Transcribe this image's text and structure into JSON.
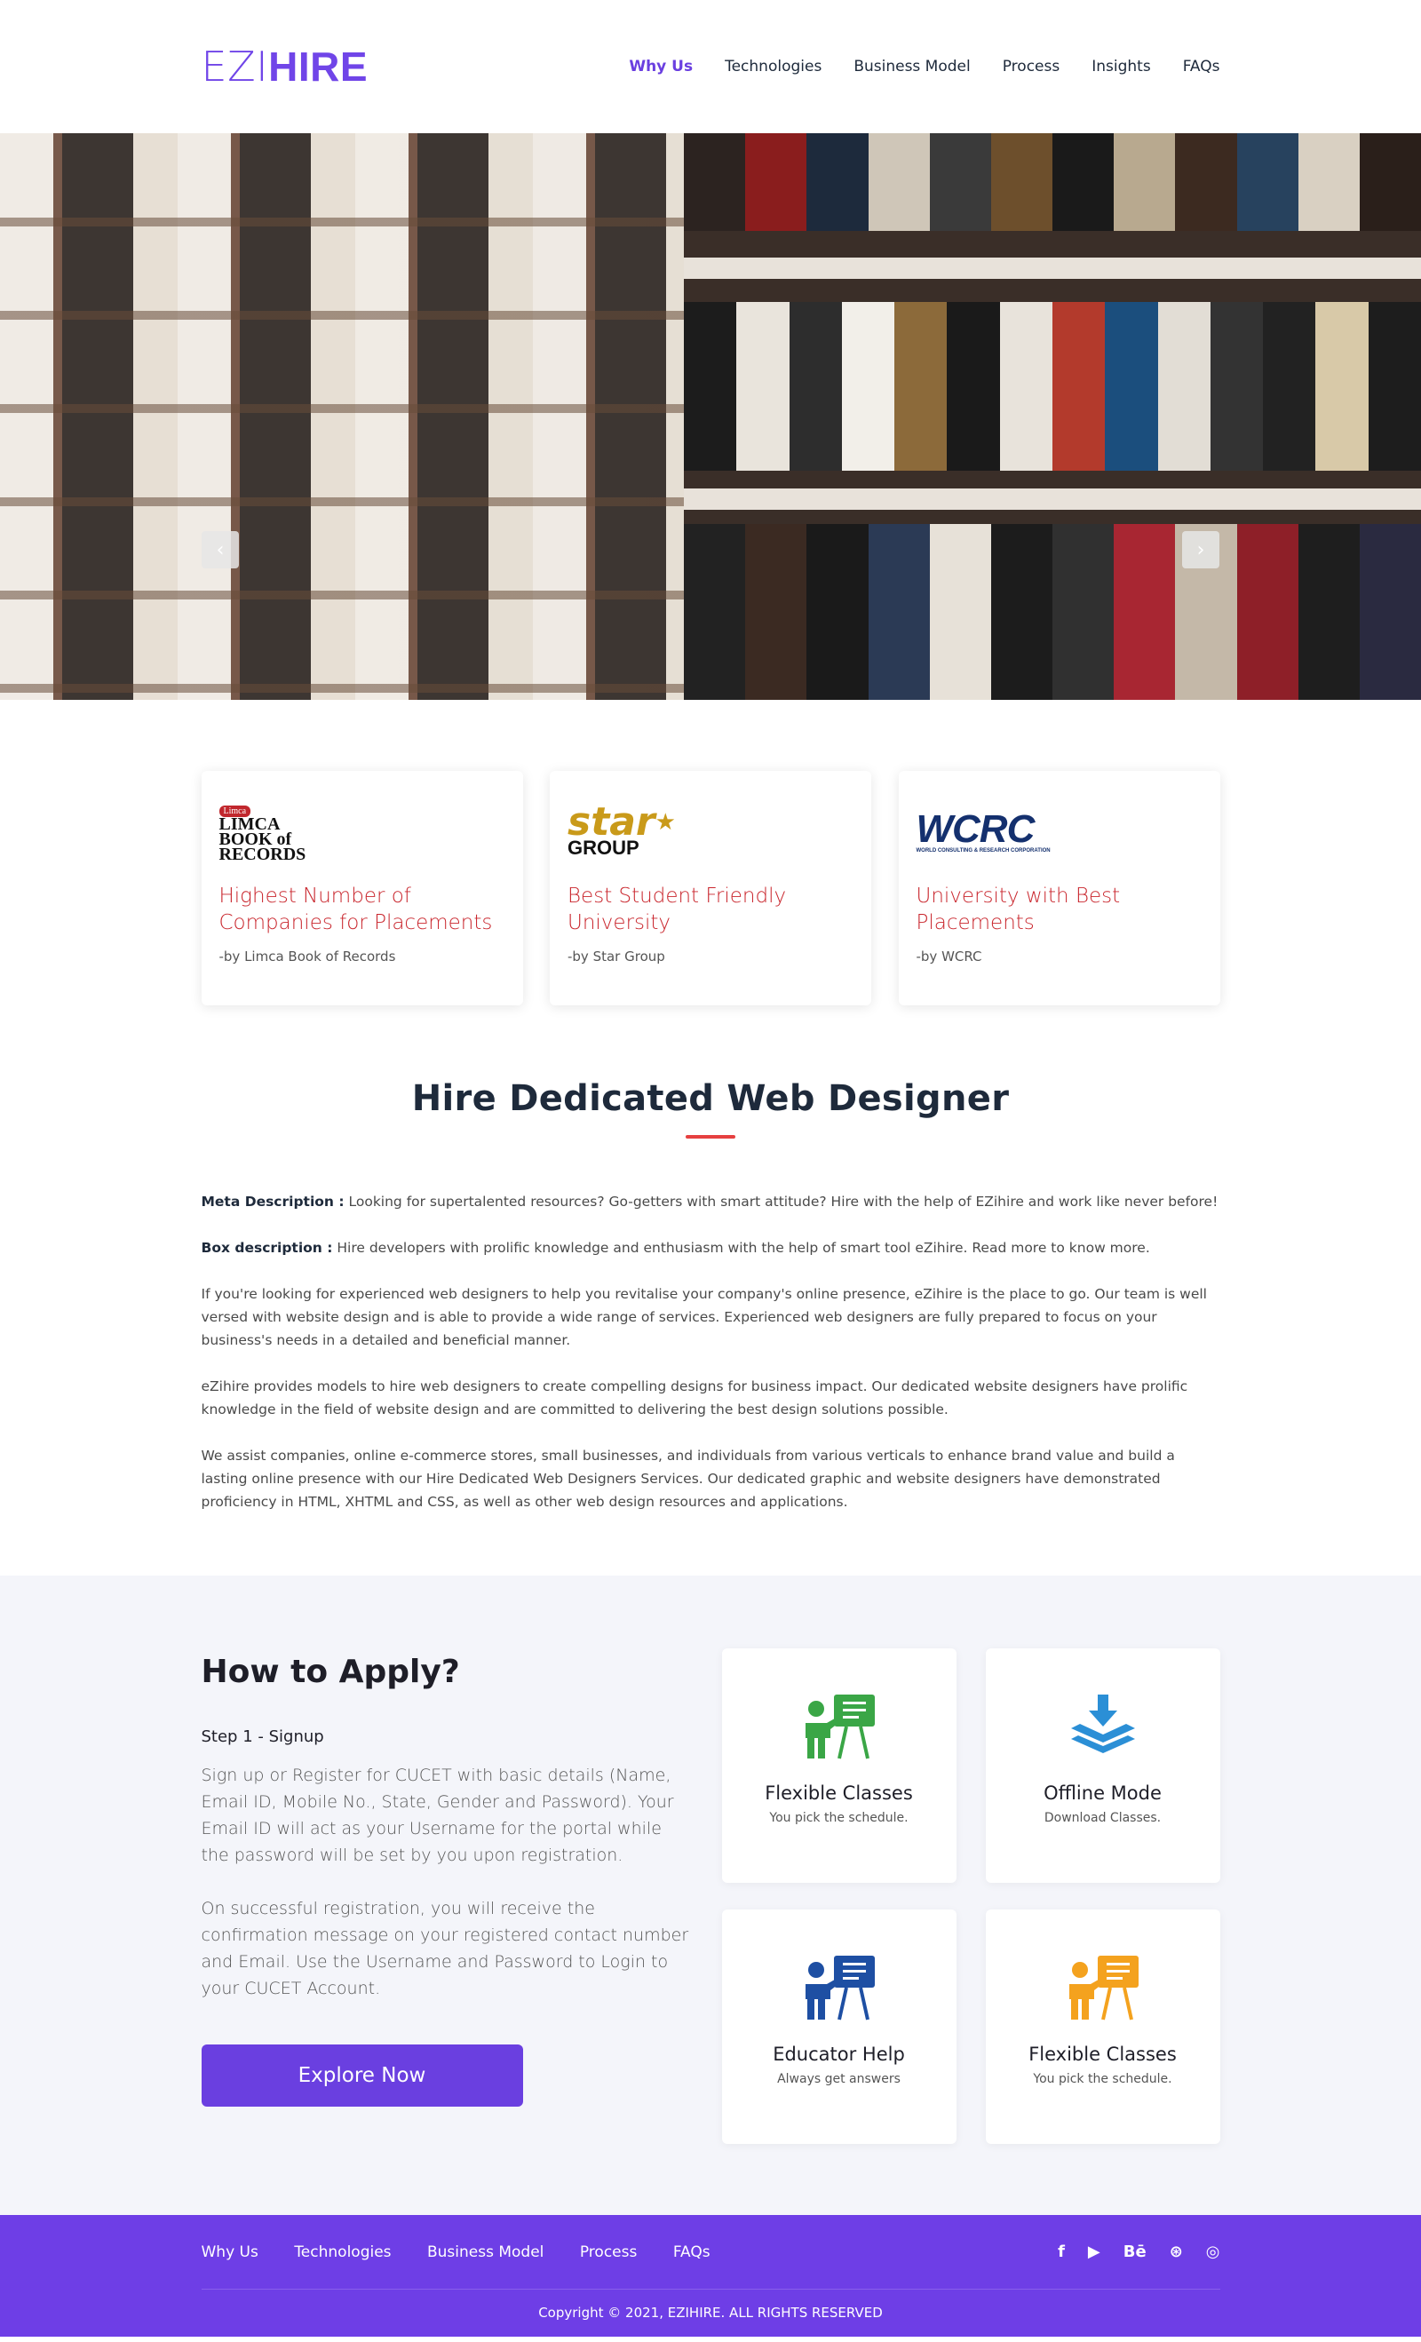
{
  "header": {
    "logo_light": "EZI",
    "logo_bold": "HIRE",
    "nav": [
      {
        "label": "Why Us"
      },
      {
        "label": "Technologies"
      },
      {
        "label": "Business Model"
      },
      {
        "label": "Process"
      },
      {
        "label": "Insights"
      },
      {
        "label": "FAQs"
      }
    ]
  },
  "hero": {
    "prev_icon": "chevron-left-icon",
    "next_icon": "chevron-right-icon"
  },
  "awards": [
    {
      "logo_line1": "Limca",
      "logo_line2": "LIMCA",
      "logo_line3": "BOOK of",
      "logo_line4": "RECORDS",
      "title": "Highest Number of Companies for Placements",
      "by": "-by Limca Book of Records"
    },
    {
      "logo_line1": "star",
      "logo_line2": "GROUP",
      "title": "Best Student Friendly University",
      "by": "-by Star Group"
    },
    {
      "logo_line1": "WCRC",
      "logo_line2": "WORLD CONSULTING & RESEARCH CORPORATION",
      "title": "University with Best Placements",
      "by": "-by WCRC"
    }
  ],
  "content": {
    "title": "Hire Dedicated Web Designer",
    "meta_label": "Meta Description :",
    "meta_text": " Looking for supertalented resources? Go-getters with smart attitude? Hire with the help of EZihire and work like never before!",
    "box_label": "Box description :",
    "box_text": " Hire developers with prolific knowledge and enthusiasm with the help of smart tool eZihire. Read more to know more.",
    "para1": "If you're looking for experienced web designers to help you revitalise your company's online presence, eZihire is the place to go. Our team is well versed with website design and is able to provide a wide range of services. Experienced web designers are fully prepared to focus on your business's needs in a detailed and beneficial manner.",
    "para2": "eZihire provides models to hire web designers to create compelling designs for business impact. Our dedicated website designers have prolific knowledge in the field of website design and are committed to delivering the best design solutions possible.",
    "para3": "We assist companies, online e-commerce stores, small businesses, and individuals from various verticals to enhance brand value and build a lasting online presence with our Hire Dedicated Web Designers Services. Our dedicated graphic and website designers have demonstrated proficiency in HTML, XHTML and CSS, as well as other web design resources and applications."
  },
  "apply": {
    "title": "How to Apply?",
    "step_title": "Step 1 - Signup",
    "para1": "Sign up or Register for CUCET with basic details (Name, Email ID, Mobile No., State, Gender and Password). Your Email ID will act as your Username for the portal while the password will be set by you upon registration.",
    "para2": "On successful registration, you will receive the confirmation message on your registered contact number and Email. Use the Username and Password to Login to your CUCET Account.",
    "button": "Explore Now",
    "features": [
      {
        "title": "Flexible Classes",
        "sub": "You pick the schedule.",
        "color": "#3aa646",
        "icon": "teacher-board-icon"
      },
      {
        "title": "Offline Mode",
        "sub": "Download Classes.",
        "color": "#2b8fd6",
        "icon": "download-layers-icon"
      },
      {
        "title": "Educator Help",
        "sub": "Always get answers",
        "color": "#1e4fa3",
        "icon": "teacher-board-icon"
      },
      {
        "title": "Flexible Classes",
        "sub": "You pick the schedule.",
        "color": "#f4a21e",
        "icon": "teacher-board-icon"
      }
    ]
  },
  "footer": {
    "nav": [
      {
        "label": "Why Us"
      },
      {
        "label": "Technologies"
      },
      {
        "label": "Business Model"
      },
      {
        "label": "Process"
      },
      {
        "label": "FAQs"
      }
    ],
    "social": [
      {
        "icon": "facebook-icon",
        "glyph": "f"
      },
      {
        "icon": "youtube-icon",
        "glyph": "▶"
      },
      {
        "icon": "behance-icon",
        "glyph": "Bē"
      },
      {
        "icon": "dribbble-icon",
        "glyph": "⊛"
      },
      {
        "icon": "instagram-icon",
        "glyph": "◎"
      }
    ],
    "copyright": "Copyright © 2021, EZIHIRE. ALL RIGHTS RESERVED"
  },
  "colors": {
    "brand": "#6a3fe0",
    "accent_red": "#c9262d",
    "footer_bg": "#6e3ee6"
  }
}
